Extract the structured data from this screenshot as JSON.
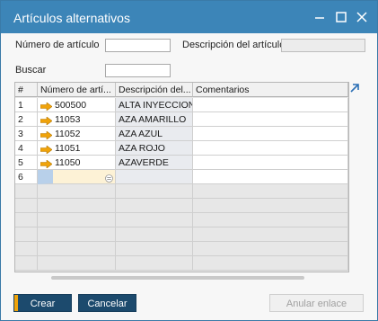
{
  "window": {
    "title": "Artículos alternativos",
    "minimize_icon": "minimize-icon",
    "maximize_icon": "maximize-icon",
    "close_icon": "close-icon"
  },
  "form": {
    "item_number_label": "Número de artículo",
    "item_number_value": "",
    "item_description_label": "Descripción del artículo",
    "item_description_value": "",
    "search_label": "Buscar",
    "search_value": ""
  },
  "grid": {
    "columns": [
      "#",
      "Número de artí...",
      "Descripción del...",
      "Comentarios"
    ],
    "rows": [
      {
        "num": "1",
        "item": "500500",
        "desc": "ALTA INYECCION",
        "comment": ""
      },
      {
        "num": "2",
        "item": "11053",
        "desc": "AZA AMARILLO",
        "comment": ""
      },
      {
        "num": "3",
        "item": "11052",
        "desc": "AZA AZUL",
        "comment": ""
      },
      {
        "num": "4",
        "item": "11051",
        "desc": "AZA ROJO",
        "comment": ""
      },
      {
        "num": "5",
        "item": "11050",
        "desc": "AZAVERDE",
        "comment": ""
      },
      {
        "num": "6",
        "item": "",
        "desc": "",
        "comment": ""
      }
    ],
    "link_arrow_icon": "link-arrow-icon",
    "expand_icon": "expand-icon",
    "choose_from_list_icon": "choose-from-list-icon"
  },
  "buttons": {
    "create": "Crear",
    "cancel": "Cancelar",
    "unlink": "Anular enlace"
  },
  "colors": {
    "titlebar": "#3c85b8",
    "primary_button": "#1c4a6d",
    "accent": "#f0a30a",
    "link_arrow": "#f0a30a",
    "active_cell": "#fdf2d6"
  }
}
